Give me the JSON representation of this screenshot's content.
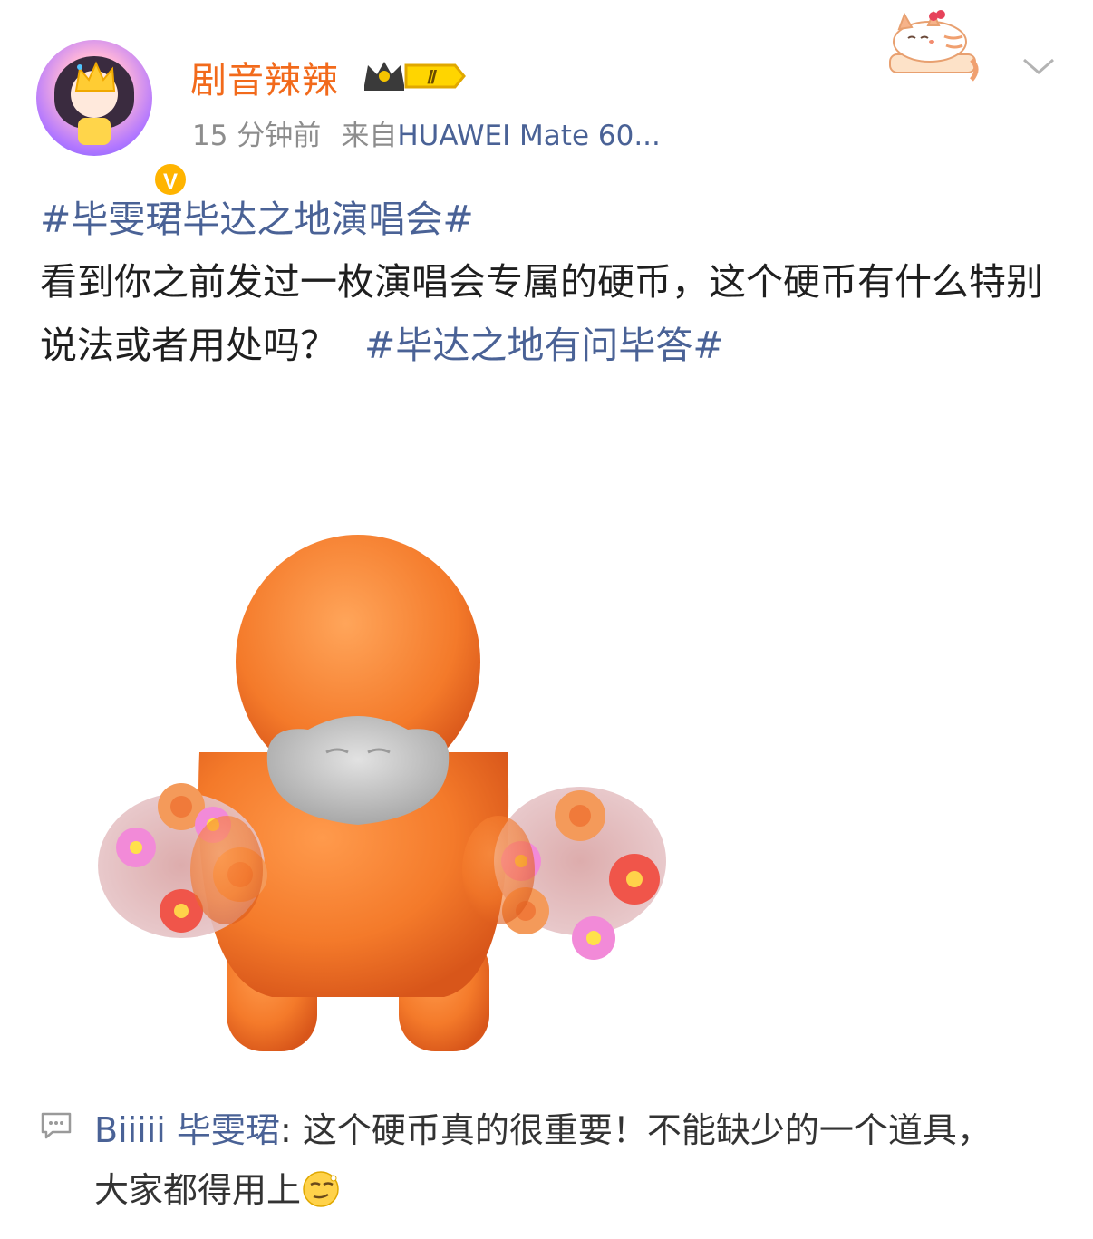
{
  "header": {
    "username": "剧音辣辣",
    "vip_level": "Ⅱ",
    "verified_badge": "V",
    "time": "15 分钟前",
    "source_prefix": "来自",
    "device": "HUAWEI Mate 60..."
  },
  "post": {
    "topic_1": "#毕雯珺毕达之地演唱会#",
    "text": "看到你之前发过一枚演唱会专属的硬币，这个硬币有什么特别说法或者用处吗？",
    "topic_2": "#毕达之地有问毕答#"
  },
  "comment": {
    "author": "Biiiii 毕雯珺",
    "separator": ":",
    "text": " 这个硬币真的很重要！不能缺少的一个道具，大家都得用上"
  },
  "icons": {
    "menu": "chevron-down-icon",
    "comment": "comment-icon",
    "emoji": "smirk-emoji-icon",
    "vip": "crown-icon"
  },
  "colors": {
    "username": "#f26a1b",
    "link": "#4a6296",
    "meta": "#8d8d8d",
    "character": "#f47a2a"
  }
}
